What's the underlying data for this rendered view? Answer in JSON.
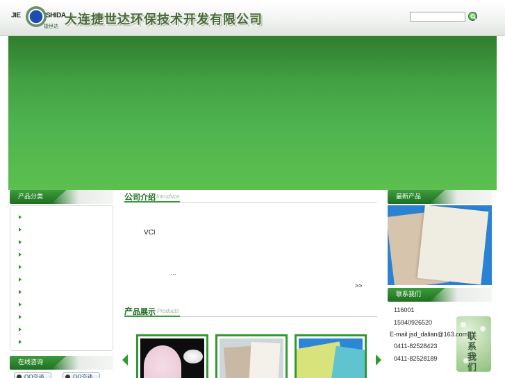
{
  "header": {
    "logo": {
      "left_text": "JIE",
      "right_text": "SHIDA",
      "chinese": "捷世达"
    },
    "company_name": "大连捷世达环保技术开发有限公司",
    "search": {
      "placeholder": ""
    }
  },
  "sidebar": {
    "category_title": "产品分类",
    "category_item_count": 11,
    "consult_title": "在线咨询",
    "qq_buttons": [
      "QQ交谈",
      "QQ交谈"
    ]
  },
  "main": {
    "intro": {
      "title_lead": "公",
      "title_rest": "司介绍",
      "title_en": "Introduce",
      "text": "VCI",
      "ellipsis": "...",
      "more": ">>"
    },
    "products": {
      "title_lead": "产",
      "title_rest": "品展示",
      "title_en": "Products"
    }
  },
  "right": {
    "new_title": "最新产品",
    "contact_title": "联系我们",
    "contact_lines": [
      "116001",
      "15940926520",
      "E-mail jsd_dalian@163.com",
      "0411-82528423",
      "0411-82528189"
    ],
    "contact_art_text": "联系我们"
  },
  "colors": {
    "brand_green": "#2f8f2f",
    "banner": "#4fb44f"
  }
}
